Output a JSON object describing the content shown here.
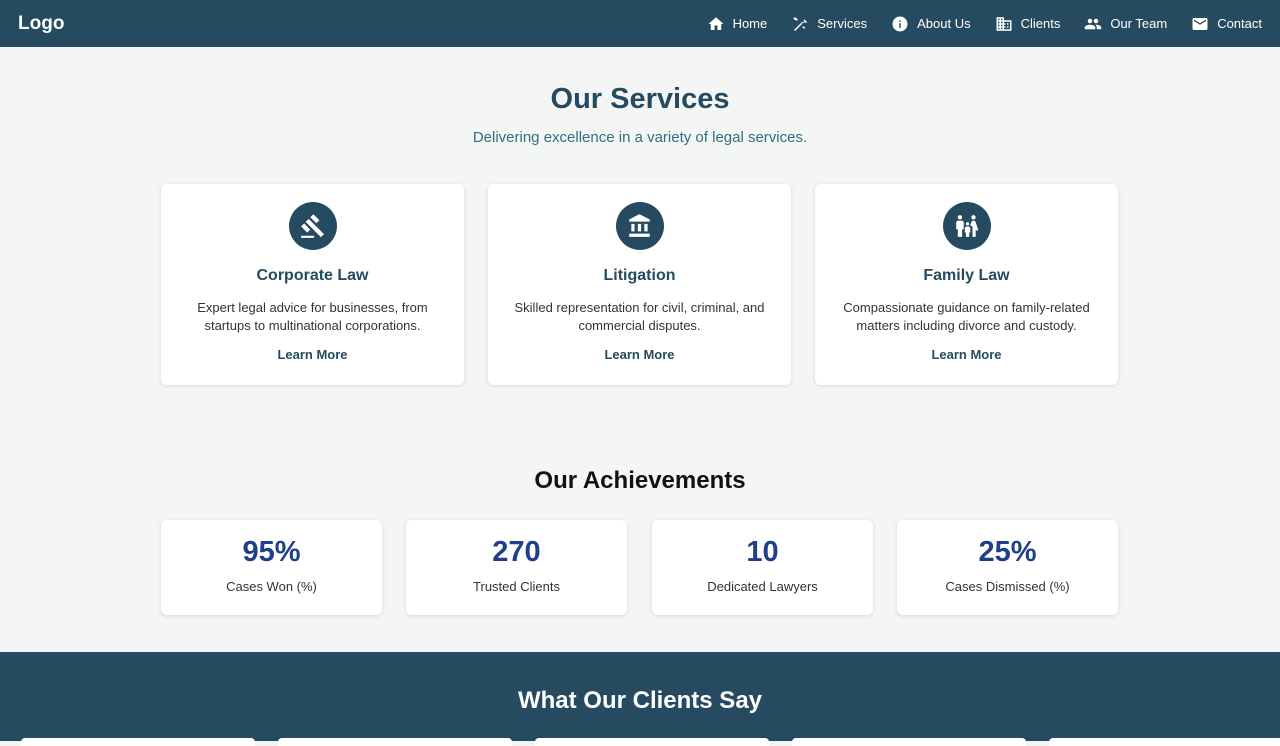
{
  "nav": {
    "logo": "Logo",
    "links": [
      {
        "label": "Home",
        "icon": "home-icon"
      },
      {
        "label": "Services",
        "icon": "tools-icon"
      },
      {
        "label": "About Us",
        "icon": "info-icon"
      },
      {
        "label": "Clients",
        "icon": "building-icon"
      },
      {
        "label": "Our Team",
        "icon": "people-icon"
      },
      {
        "label": "Contact",
        "icon": "mail-icon"
      }
    ]
  },
  "services": {
    "title": "Our Services",
    "subtitle": "Delivering excellence in a variety of legal services.",
    "cards": [
      {
        "icon": "gavel-icon",
        "title": "Corporate Law",
        "description": "Expert legal advice for businesses, from startups to multinational corporations.",
        "link": "Learn More"
      },
      {
        "icon": "courthouse-icon",
        "title": "Litigation",
        "description": "Skilled representation for civil, criminal, and commercial disputes.",
        "link": "Learn More"
      },
      {
        "icon": "family-icon",
        "title": "Family Law",
        "description": "Compassionate guidance on family-related matters including divorce and custody.",
        "link": "Learn More"
      }
    ]
  },
  "achievements": {
    "title": "Our Achievements",
    "stats": [
      {
        "value": "95%",
        "label": "Cases Won (%)"
      },
      {
        "value": "270",
        "label": "Trusted Clients"
      },
      {
        "value": "10",
        "label": "Dedicated Lawyers"
      },
      {
        "value": "25%",
        "label": "Cases Dismissed (%)"
      }
    ]
  },
  "testimonials": {
    "title": "What Our Clients Say"
  },
  "colors": {
    "primary": "#264a60",
    "stat_number": "#1f3f8a",
    "subtitle": "#2f6f7e",
    "background": "#f4f6f5"
  }
}
